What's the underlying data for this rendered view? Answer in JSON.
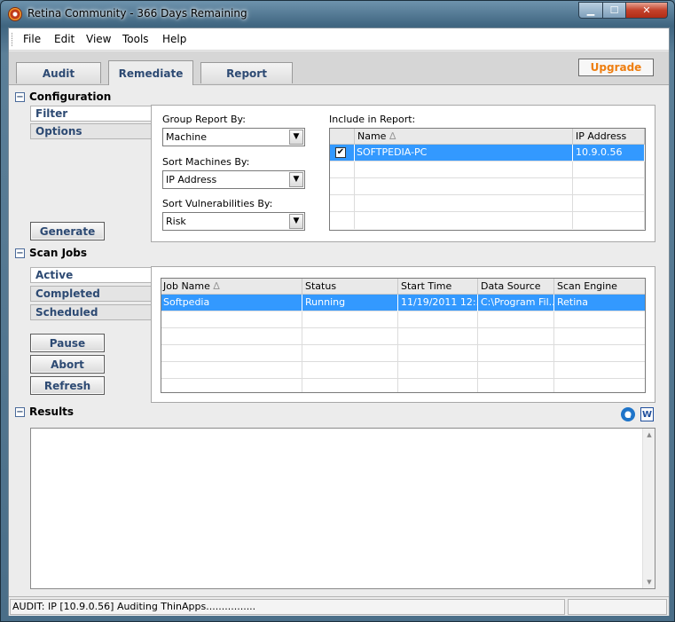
{
  "window": {
    "title": "Retina Community - 366  Days Remaining"
  },
  "menu": [
    "File",
    "Edit",
    "View",
    "Tools",
    "Help"
  ],
  "tabs": [
    "Audit",
    "Remediate",
    "Report"
  ],
  "upgrade_label": "Upgrade",
  "configuration": {
    "title": "Configuration",
    "side_tabs": [
      "Filter",
      "Options"
    ],
    "group_label": "Group Report By:",
    "group_value": "Machine",
    "sort_machines_label": "Sort Machines By:",
    "sort_machines_value": "IP Address",
    "sort_vulns_label": "Sort Vulnerabilities By:",
    "sort_vulns_value": "Risk",
    "include_label": "Include in Report:",
    "include_columns": [
      "Name",
      "IP Address"
    ],
    "include_rows": [
      {
        "checked": "✔",
        "name": "SOFTPEDIA-PC",
        "ip": "10.9.0.56"
      }
    ],
    "generate_label": "Generate"
  },
  "scan_jobs": {
    "title": "Scan Jobs",
    "side_tabs": [
      "Active",
      "Completed",
      "Scheduled"
    ],
    "columns": [
      "Job Name",
      "Status",
      "Start Time",
      "Data Source",
      "Scan Engine"
    ],
    "rows": [
      {
        "job": "Softpedia",
        "status": "Running",
        "start": "11/19/2011 12:...",
        "source": "C:\\Program Fil...",
        "engine": "Retina"
      }
    ],
    "buttons": [
      "Pause",
      "Abort",
      "Refresh"
    ]
  },
  "results": {
    "title": "Results"
  },
  "status": {
    "text": "AUDIT: IP [10.9.0.56] Auditing ThinApps................"
  }
}
